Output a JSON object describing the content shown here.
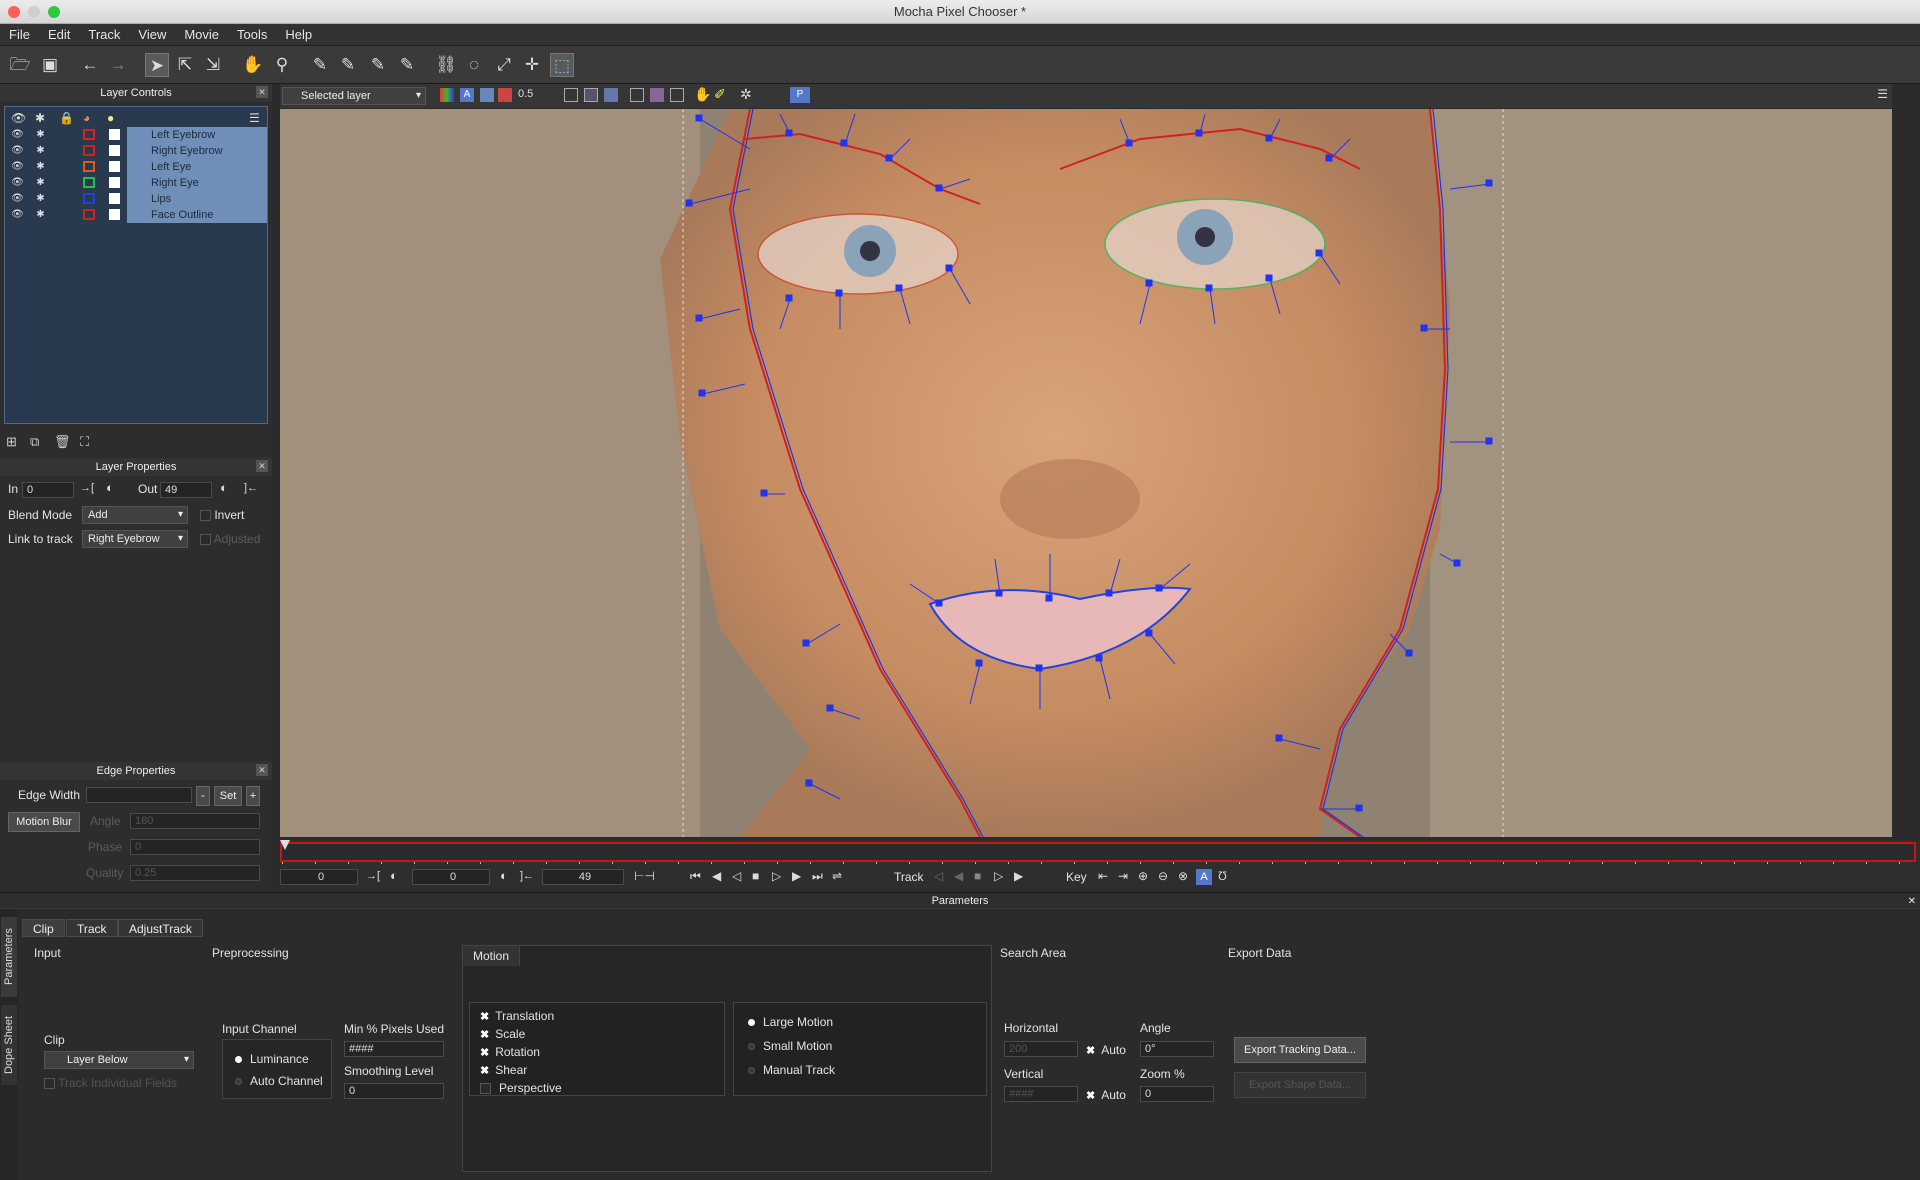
{
  "window": {
    "title": "Mocha Pixel Chooser *"
  },
  "menu": [
    "File",
    "Edit",
    "Track",
    "View",
    "Movie",
    "Tools",
    "Help"
  ],
  "layer_controls": {
    "title": "Layer Controls",
    "layers": [
      "Left Eyebrow",
      "Right Eyebrow",
      "Left Eye",
      "Right Eye",
      "Lips",
      "Face Outline"
    ],
    "swatch_colors": [
      "#e02020",
      "#d02020",
      "#e05a10",
      "#20c040",
      "#2040e0",
      "#d02020"
    ]
  },
  "layer_properties": {
    "title": "Layer Properties",
    "in_label": "In",
    "in_value": "0",
    "out_label": "Out",
    "out_value": "49",
    "blend_mode_label": "Blend Mode",
    "blend_mode_value": "Add",
    "invert_label": "Invert",
    "link_label": "Link to track",
    "link_value": "Right Eyebrow",
    "adjusted_label": "Adjusted"
  },
  "edge_properties": {
    "title": "Edge Properties",
    "edge_width_label": "Edge Width",
    "minus": "-",
    "set": "Set",
    "plus": "+",
    "motion_blur": "Motion Blur",
    "angle_label": "Angle",
    "angle_value": "180",
    "phase_label": "Phase",
    "phase_value": "0",
    "quality_label": "Quality",
    "quality_value": "0.25"
  },
  "viewer": {
    "layer_select": "Selected layer",
    "opacity": "0.5",
    "overlay_color": "#d8b08a"
  },
  "transport": {
    "start": "0",
    "current": "0",
    "end": "49",
    "track_label": "Track",
    "key_label": "Key"
  },
  "parameters": {
    "title": "Parameters",
    "side_tabs": [
      "Parameters",
      "Dope Sheet"
    ],
    "tabs": [
      "Clip",
      "Track",
      "AdjustTrack"
    ],
    "input": {
      "title": "Input",
      "clip_label": "Clip",
      "clip_value": "Layer Below",
      "track_individual": "Track Individual Fields"
    },
    "preprocessing": {
      "title": "Preprocessing",
      "input_channel_label": "Input Channel",
      "luminance": "Luminance",
      "auto_channel": "Auto Channel",
      "min_pixels_label": "Min % Pixels Used",
      "min_pixels_value": "####",
      "smoothing_label": "Smoothing Level",
      "smoothing_value": "0"
    },
    "motion": {
      "title": "Motion",
      "checks": [
        "Translation",
        "Scale",
        "Rotation",
        "Shear",
        "Perspective"
      ],
      "checked": [
        true,
        true,
        true,
        true,
        false
      ],
      "radios": [
        "Large Motion",
        "Small Motion",
        "Manual Track"
      ]
    },
    "search_area": {
      "title": "Search Area",
      "horizontal_label": "Horizontal",
      "horizontal_value": "200",
      "vertical_label": "Vertical",
      "vertical_value": "####",
      "auto": "Auto",
      "angle_label": "Angle",
      "angle_value": "0°",
      "zoom_label": "Zoom %",
      "zoom_value": "0"
    },
    "export": {
      "title": "Export Data",
      "export_tracking": "Export Tracking Data...",
      "export_shape": "Export Shape Data..."
    }
  }
}
